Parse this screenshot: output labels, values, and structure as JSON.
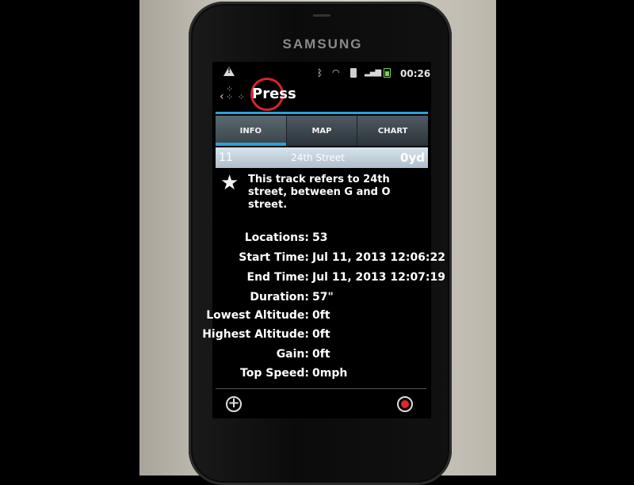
{
  "device": {
    "brand": "SAMSUNG"
  },
  "status_bar": {
    "time": "00:26",
    "icons": [
      "warning-icon",
      "bluetooth-icon",
      "wifi-icon",
      "sim-icon",
      "signal-icon",
      "battery-icon"
    ]
  },
  "title_bar": {
    "title": "Press",
    "icons": [
      "back-icon",
      "app-paw-icon"
    ]
  },
  "tabs": [
    {
      "label": "INFO",
      "active": true
    },
    {
      "label": "MAP",
      "active": false
    },
    {
      "label": "CHART",
      "active": false
    }
  ],
  "track": {
    "number": "11",
    "name": "24th Street",
    "distance": "0yd"
  },
  "description": "This track refers to 24th street, between G and O street.",
  "stats": [
    {
      "label": "Locations:",
      "value": "53"
    },
    {
      "label": "Start Time:",
      "value": "Jul 11, 2013 12:06:22"
    },
    {
      "label": "End Time:",
      "value": "Jul 11, 2013 12:07:19"
    },
    {
      "label": "Duration:",
      "value": "57\""
    },
    {
      "label": "Lowest Altitude:",
      "value": "0ft"
    },
    {
      "label": "Highest Altitude:",
      "value": "0ft"
    },
    {
      "label": "Gain:",
      "value": "0ft"
    },
    {
      "label": "Top Speed:",
      "value": "0mph"
    }
  ],
  "colors": {
    "accent": "#2aa2d6",
    "highlight_circle": "#d8242c",
    "record": "#e0262e"
  }
}
